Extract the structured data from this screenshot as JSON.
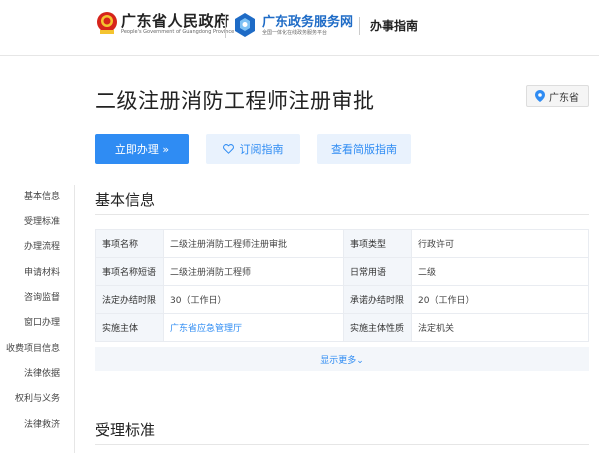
{
  "header": {
    "site_name": "广东省人民政府",
    "site_sub": "People's Government of Guangdong Province",
    "portal_name": "广东政务服务网",
    "portal_sub": "全国一体化在线政务服务平台",
    "section": "办事指南"
  },
  "item": {
    "title": "二级注册消防工程师注册审批",
    "region": "广东省"
  },
  "actions": {
    "apply": "立即办理 »",
    "subscribe": "订阅指南",
    "simple": "查看简版指南"
  },
  "leftnav": {
    "items": [
      "基本信息",
      "受理标准",
      "办理流程",
      "申请材料",
      "咨询监督",
      "窗口办理",
      "收费项目信息",
      "法律依据",
      "权利与义务",
      "法律救济"
    ]
  },
  "basic_info": {
    "title": "基本信息",
    "rows": [
      [
        "事项名称",
        "二级注册消防工程师注册审批",
        "事项类型",
        "行政许可"
      ],
      [
        "事项名称短语",
        "二级注册消防工程师",
        "日常用语",
        "二级"
      ],
      [
        "法定办结时限",
        "30（工作日）",
        "承诺办结时限",
        "20（工作日）"
      ],
      [
        "实施主体",
        "广东省应急管理厅",
        "实施主体性质",
        "法定机关"
      ]
    ],
    "show_more": "显示更多⌄"
  },
  "acceptance": {
    "title": "受理标准"
  },
  "colors": {
    "primary": "#2f8cf3",
    "portal_blue": "#1e6bc6",
    "key_bg": "#f3f6fa"
  },
  "icons": {
    "emblem": "national-emblem-icon",
    "portal_logo": "gdzw-logo-icon",
    "pin": "location-pin-icon",
    "heart": "heart-icon"
  }
}
